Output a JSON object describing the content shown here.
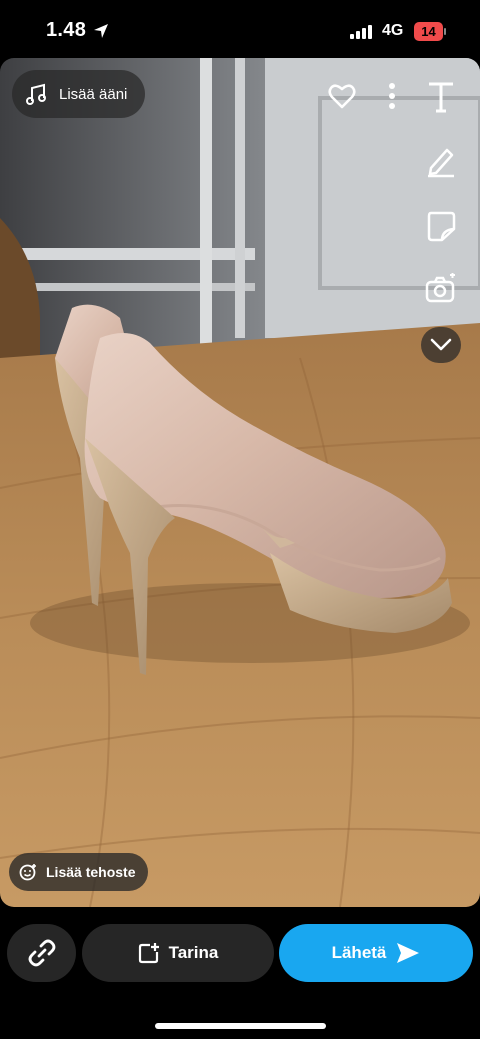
{
  "status_bar": {
    "time": "1.48",
    "location_icon": "location-arrow-icon",
    "signal_icon": "cellular-signal-icon",
    "network": "4G",
    "battery_level": "14",
    "battery_color": "#f04b4b"
  },
  "photo": {
    "icon": "shoe-photo"
  },
  "overlay": {
    "sound_button": {
      "label": "Lisää ääni",
      "icon": "music-note-icon"
    },
    "favorite_icon": "heart-icon",
    "more_icon": "more-vertical-icon",
    "tools": [
      "text-tool-icon",
      "pencil-icon",
      "sticker-icon",
      "camera-flip-icon"
    ],
    "expand_icon": "chevron-down-icon",
    "effect_button": {
      "label": "Lisää tehoste",
      "icon": "smile-plus-icon"
    }
  },
  "bottom_bar": {
    "link_icon": "link-icon",
    "story_button": {
      "label": "Tarina",
      "icon": "story-add-icon"
    },
    "send_button": {
      "label": "Lähetä",
      "icon": "send-arrow-icon",
      "color": "#19a7f0"
    }
  }
}
